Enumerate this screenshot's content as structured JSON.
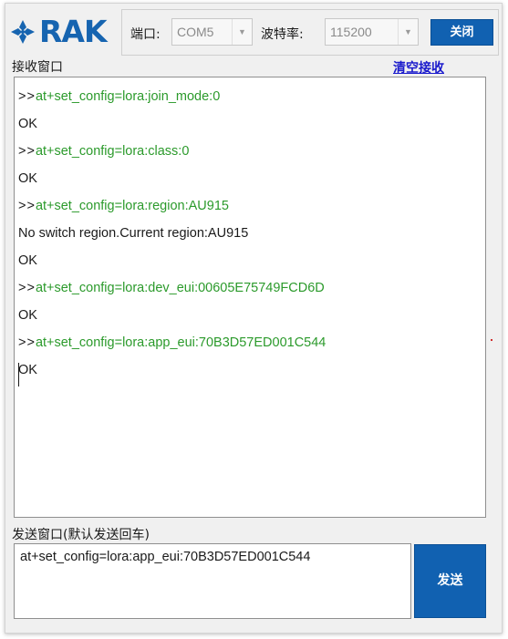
{
  "header": {
    "logo_text": "RAK",
    "port_label": "端口:",
    "port_value": "COM5",
    "baud_label": "波特率:",
    "baud_value": "115200",
    "close_button": "关闭",
    "brand_color": "#1664b0"
  },
  "receive": {
    "title": "接收窗口",
    "clear_link": "清空接收",
    "prompt": ">>",
    "lines": [
      {
        "type": "cmd",
        "text": "at+set_config=lora:join_mode:0"
      },
      {
        "type": "resp",
        "text": "OK"
      },
      {
        "type": "cmd",
        "text": "at+set_config=lora:class:0"
      },
      {
        "type": "resp",
        "text": "OK"
      },
      {
        "type": "cmd",
        "text": "at+set_config=lora:region:AU915"
      },
      {
        "type": "resp",
        "text": "No switch region.Current region:AU915"
      },
      {
        "type": "resp",
        "text": "OK"
      },
      {
        "type": "cmd",
        "text": "at+set_config=lora:dev_eui:00605E75749FCD6D"
      },
      {
        "type": "resp",
        "text": "OK"
      },
      {
        "type": "cmd",
        "text": "at+set_config=lora:app_eui:70B3D57ED001C544"
      },
      {
        "type": "resp",
        "text": "OK"
      }
    ],
    "cmd_color": "#2b9a2b"
  },
  "send": {
    "title": "发送窗口(默认发送回车)",
    "input_value": "at+set_config=lora:app_eui:70B3D57ED001C544",
    "send_button": "发送"
  }
}
